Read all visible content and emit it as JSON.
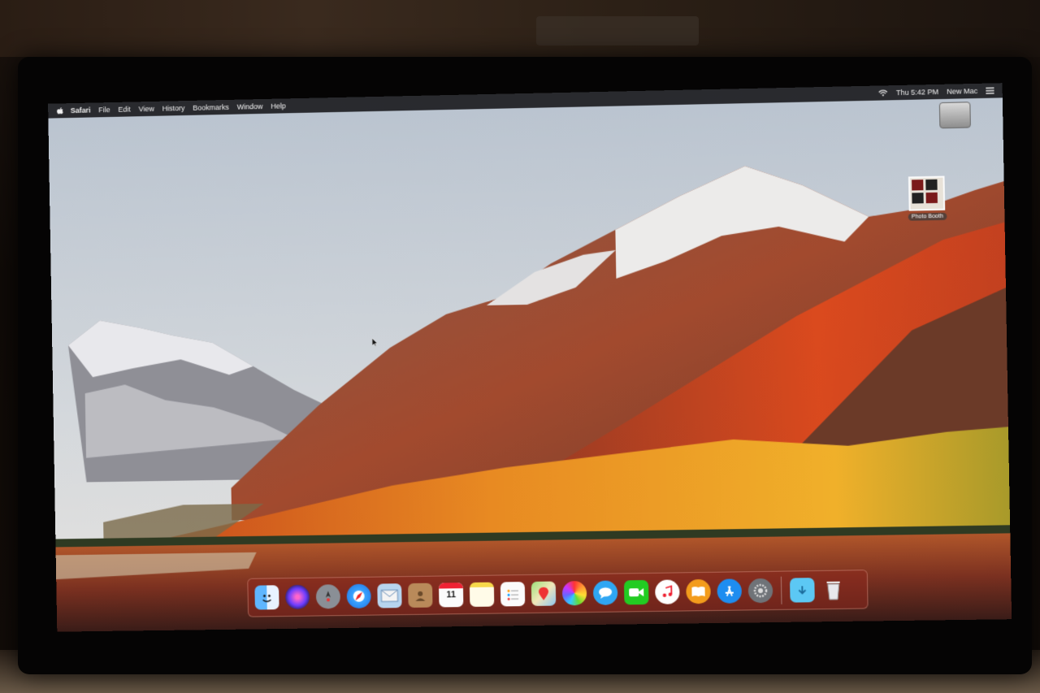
{
  "menubar": {
    "app_name": "Safari",
    "items": [
      "File",
      "Edit",
      "View",
      "History",
      "Bookmarks",
      "Window",
      "Help"
    ],
    "clock": "Thu 5:42 PM",
    "user": "New Mac"
  },
  "desktop": {
    "disk_label": "",
    "photo_label": "Photo Booth"
  },
  "dock": {
    "calendar_day": "11",
    "apps": [
      "finder-icon",
      "siri-icon",
      "launchpad-icon",
      "safari-icon",
      "mail-icon",
      "contacts-icon",
      "calendar-icon",
      "notes-icon",
      "reminders-icon",
      "maps-icon",
      "photos-icon",
      "messages-icon",
      "facetime-icon",
      "itunes-icon",
      "ibooks-icon",
      "app-store-icon",
      "system-preferences-icon",
      "downloads-folder-icon",
      "trash-icon"
    ]
  },
  "colors": {
    "dock_tint": "#8c281e",
    "sky": "#c9d2dc",
    "autumn": "#d8621e"
  }
}
